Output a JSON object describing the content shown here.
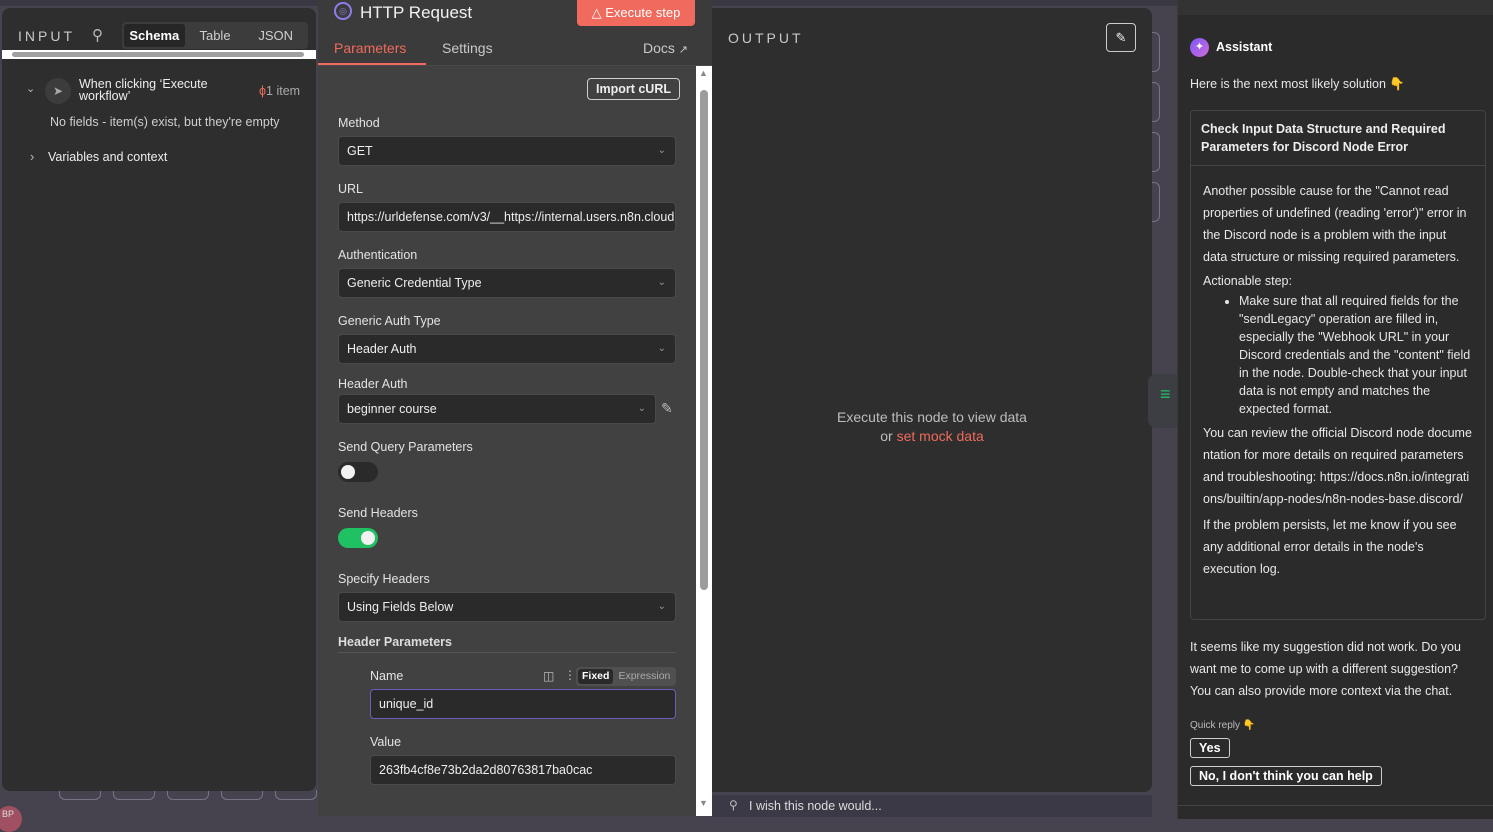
{
  "input": {
    "title": "INPUT",
    "tabs": [
      "Schema",
      "Table",
      "JSON"
    ],
    "trigger": "When clicking ‘Execute workflow’",
    "item_count": "1 item",
    "empty_msg": "No fields - item(s) exist, but they're empty",
    "variables": "Variables and context"
  },
  "node": {
    "title": "HTTP Request",
    "execute": "Execute step",
    "tabs": [
      "Parameters",
      "Settings"
    ],
    "docs": "Docs",
    "import_curl": "Import cURL",
    "method_label": "Method",
    "method": "GET",
    "url_label": "URL",
    "url": "https://urldefense.com/v3/__https://internal.users.n8n.cloud",
    "auth_label": "Authentication",
    "auth": "Generic Credential Type",
    "gat_label": "Generic Auth Type",
    "gat": "Header Auth",
    "ha_label": "Header Auth",
    "ha": "beginner course",
    "sqp_label": "Send Query Parameters",
    "sqp_on": false,
    "sh_label": "Send Headers",
    "sh_on": true,
    "spec_label": "Specify Headers",
    "spec": "Using Fields Below",
    "hp_label": "Header Parameters",
    "name_label": "Name",
    "fixed": "Fixed",
    "expression": "Expression",
    "name_value": "unique_id",
    "value_label": "Value",
    "value": "263fb4cf8e73b2da2d80763817ba0cac"
  },
  "output": {
    "title": "OUTPUT",
    "empty": "Execute this node to view data",
    "or": "or",
    "mock": "set mock data",
    "feedback": "I wish this node would..."
  },
  "assistant": {
    "title": "Assistant",
    "intro": "Here is the next most likely solution 👇",
    "card_title": "Check Input Data Structure and Required Parameters for Discord Node Error",
    "p1": "Another possible cause for the \"Cannot read properties of undefined (reading 'error')\" error in the Discord node is a problem with the input data structure or missing required parameters.",
    "p2": "Actionable step:",
    "bullet": "Make sure that all required fields for the \"sendLegacy\" operation are filled in, especially the \"Webhook URL\" in your Discord credentials and the \"content\" field in the node. Double-check that your input data is not empty and matches the expected format.",
    "p3": "You can review the official Discord node documentation for more details on required parameters and troubleshooting: https://docs.n8n.io/integrations/builtin/app-nodes/n8n-nodes-base.discord/",
    "p4": "If the problem persists, let me know if you see any additional error details in the node's execution log.",
    "followup": "It seems like my suggestion did not work. Do you want me to come up with a different suggestion? You can also provide more context via the chat.",
    "quick_label": "Quick reply 👇",
    "yes": "Yes",
    "no": "No, I don't think you can help"
  },
  "colors": {
    "accent": "#f06a5d",
    "toggle_on": "#20c162",
    "assistant_icon": "#9b5de5"
  }
}
